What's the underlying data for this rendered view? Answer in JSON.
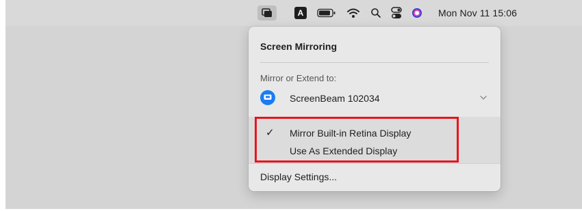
{
  "menubar": {
    "icons": [
      "screen-mirroring-icon",
      "input-source-icon",
      "battery-icon",
      "wifi-icon",
      "spotlight-search-icon",
      "control-center-icon",
      "siri-icon"
    ],
    "input_source_letter": "A",
    "clock": "Mon Nov 11  15:06"
  },
  "menu": {
    "title": "Screen Mirroring",
    "section_label": "Mirror or Extend to:",
    "device": {
      "name": "ScreenBeam 102034",
      "icon": "appletv-display-icon",
      "icon_color": "#1a7cf3"
    },
    "options": [
      {
        "label": "Mirror Built-in Retina Display",
        "checked": true,
        "check_glyph": "✓"
      },
      {
        "label": "Use As Extended Display",
        "checked": false,
        "check_glyph": ""
      }
    ],
    "settings_label": "Display Settings..."
  },
  "annotation": {
    "highlight_color": "#e8141d"
  }
}
